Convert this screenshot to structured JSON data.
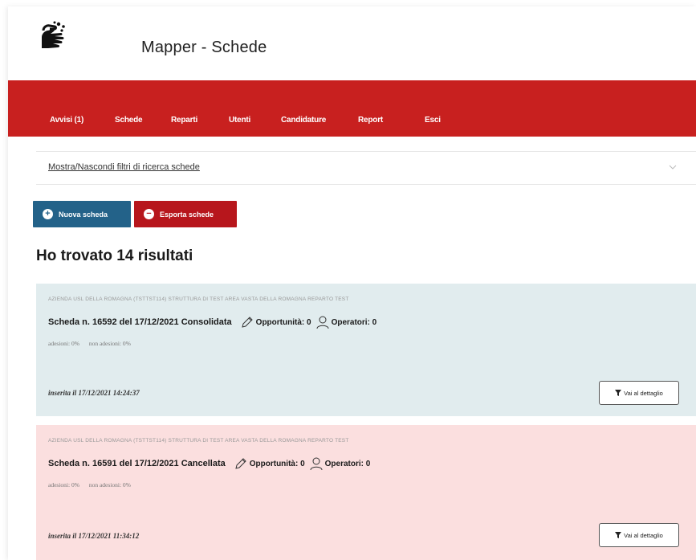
{
  "app": {
    "title": "Mapper - Schede"
  },
  "nav": {
    "items": [
      {
        "label": "Avvisi (1)"
      },
      {
        "label": "Schede"
      },
      {
        "label": "Reparti"
      },
      {
        "label": "Utenti"
      },
      {
        "label": "Candidature"
      },
      {
        "label": "Report"
      },
      {
        "label": "Esci"
      }
    ]
  },
  "filters": {
    "toggle_label": "Mostra/Nascondi filtri di ricerca schede"
  },
  "actions": {
    "new_label": "Nuova scheda",
    "export_label": "Esporta schede"
  },
  "results": {
    "title": "Ho trovato 14 risultati"
  },
  "cards": [
    {
      "path": "AZIENDA USL DELLA ROMAGNA (TSTTST114) STRUTTURA DI TEST AREA VASTA DELLA ROMAGNA REPARTO TEST",
      "title": "Scheda n. 16592 del 17/12/2021 Consolidata",
      "opportunita": "Opportunità: 0",
      "operatori": "Operatori: 0",
      "adesioni": "adesioni: 0%",
      "non_adesioni": "non adesioni: 0%",
      "inserted": "inserita il 17/12/2021 14:24:37",
      "detail_label": "Vai al dettaglio",
      "status_color": "#e1ecee"
    },
    {
      "path": "AZIENDA USL DELLA ROMAGNA (TSTTST114) STRUTTURA DI TEST AREA VASTA DELLA ROMAGNA REPARTO TEST",
      "title": "Scheda n. 16591 del 17/12/2021 Cancellata",
      "opportunita": "Opportunità: 0",
      "operatori": "Operatori: 0",
      "adesioni": "adesioni: 0%",
      "non_adesioni": "non adesioni: 0%",
      "inserted": "inserita il 17/12/2021 11:34:12",
      "detail_label": "Vai al dettaglio",
      "status_color": "#fbdfdf"
    }
  ],
  "icons": {
    "logo": "hands-sanitize-logo",
    "filter_toggle": "chevron-down-icon",
    "new": "plus-circle-icon",
    "export": "minus-circle-icon",
    "edit": "pencil-icon",
    "user": "user-icon",
    "detail": "filter-icon"
  },
  "colors": {
    "nav_background": "#c8201f",
    "new_button": "#236289",
    "export_button": "#b7161c"
  }
}
